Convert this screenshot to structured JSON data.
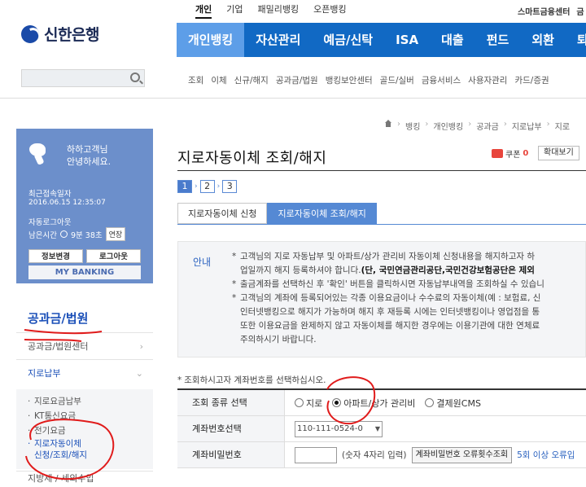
{
  "header": {
    "logo_text": "신한은행",
    "top_nav": [
      "개인",
      "기업",
      "패밀리뱅킹",
      "오픈뱅킹"
    ],
    "top_nav_active": "개인",
    "top_util": [
      "스마트금융센터",
      "금"
    ],
    "gnb": [
      "개인뱅킹",
      "자산관리",
      "예금/신탁",
      "ISA",
      "대출",
      "펀드",
      "외환",
      "퇴직연"
    ],
    "gnb_active": "개인뱅킹",
    "sub_nav": [
      "조회",
      "이체",
      "신규/해지",
      "공과금/법원",
      "뱅킹보안센터",
      "골드/실버",
      "금융서비스",
      "사용자관리",
      "카드/증권"
    ]
  },
  "sidebar": {
    "greeting_line1": "하하고객님",
    "greeting_line2": "안녕하세요.",
    "last_login_label": "최근접속일자",
    "last_login_value": "2016.06.15 12:35:07",
    "auto_logout_label": "자동로그아웃",
    "remaining_label": "남은시간",
    "remaining_value": "9분 38초",
    "extend_label": "연장",
    "info_change_label": "정보변경",
    "logout_label": "로그아웃",
    "my_banking_label": "MY BANKING",
    "section_title": "공과금/법원",
    "menu": [
      {
        "label": "공과금/법원센터"
      },
      {
        "label": "지로납부"
      }
    ],
    "sub_menu": [
      "지로요금납부",
      "KT통신요금",
      "전기요금"
    ],
    "sub_menu_active_line1": "지로자동이체",
    "sub_menu_active_line2": "신청/조회/해지",
    "last_item": "지방세 / 세외수입"
  },
  "main": {
    "breadcrumb": [
      "뱅킹",
      "개인뱅킹",
      "공과금",
      "지로납부",
      "지로"
    ],
    "page_title": "지로자동이체 조회/해지",
    "coupon_label": "쿠폰",
    "coupon_count": "0",
    "zoom_label": "확대보기",
    "steps": [
      "1",
      "2",
      "3"
    ],
    "tabs": [
      "지로자동이체 신청",
      "지로자동이체 조회/해지"
    ],
    "notice_label": "안내",
    "notice": {
      "l1": "고객님의 지로 자동납부 및 아파트/상가 관리비 자동이체 신청내용을 해지하고자 하",
      "l2a": "업일까지 해지 등록하셔야 합니다.",
      "l2b": "(단, 국민연금관리공단,국민건강보험공단은 제외",
      "l3": "출금계좌를 선택하신 후 '확인' 버튼을 클릭하시면 자동납부내역을 조회하실 수 있습니",
      "l4": "고객님의 계좌에 등록되어있는 각종 이용요금이나 수수료의 자동이체(예 : 보험료, 신",
      "l5": "인터넷뱅킹으로 해지가 가능하며 해지 후 재등록 시에는 인터넷뱅킹이나 영업점을 통",
      "l6": "또한 이용요금을 완제하지 않고 자동이체를 해지한 경우에는 이용기관에 대한 연체료",
      "l7": "주의하시기 바랍니다."
    },
    "form_hint": "조회하시고자 계좌번호를 선택하십시오.",
    "form": {
      "type_label": "조회 종류 선택",
      "radio_giro": "지로",
      "radio_apt": "아파트/상가 관리비",
      "radio_cms": "결제원CMS",
      "account_label": "계좌번호선택",
      "account_value": "110-111-0524-0",
      "password_label": "계좌비밀번호",
      "password_note": "(숫자 4자리 입력)",
      "error_btn": "계좌비밀번호 오류횟수조회",
      "error_note": "5회 이상 오류입"
    }
  }
}
